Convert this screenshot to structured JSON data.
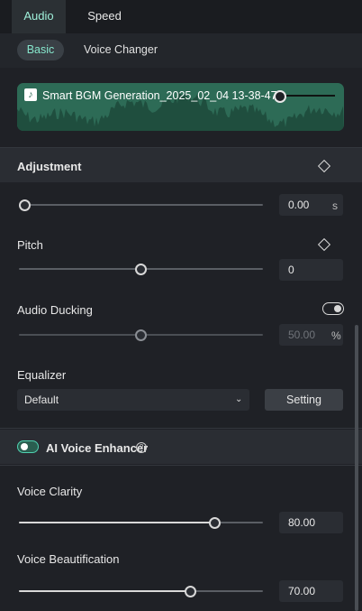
{
  "tabs": {
    "audio": "Audio",
    "speed": "Speed"
  },
  "subtabs": {
    "basic": "Basic",
    "voice_changer": "Voice Changer"
  },
  "clip": {
    "title": "Smart BGM Generation_2025_02_04 13-38-47"
  },
  "adjustment": {
    "title": "Adjustment",
    "slider1": {
      "value": "0.00",
      "unit": "s",
      "level": 0.0
    }
  },
  "pitch": {
    "label": "Pitch",
    "value": "0",
    "level": 0.5
  },
  "ducking": {
    "label": "Audio Ducking",
    "value": "50.00",
    "unit": "%",
    "level": 0.5,
    "enabled": false
  },
  "equalizer": {
    "label": "Equalizer",
    "preset": "Default",
    "setting_button": "Setting"
  },
  "ai_enhancer": {
    "title": "AI Voice Enhancer",
    "enabled": true
  },
  "voice_clarity": {
    "label": "Voice Clarity",
    "value": "80.00",
    "level": 0.8
  },
  "voice_beautification": {
    "label": "Voice Beautification",
    "value": "70.00",
    "level": 0.7
  },
  "colors": {
    "accent": "#4fd1b0",
    "wave": "#2d6b56",
    "panel": "#1f2126"
  }
}
